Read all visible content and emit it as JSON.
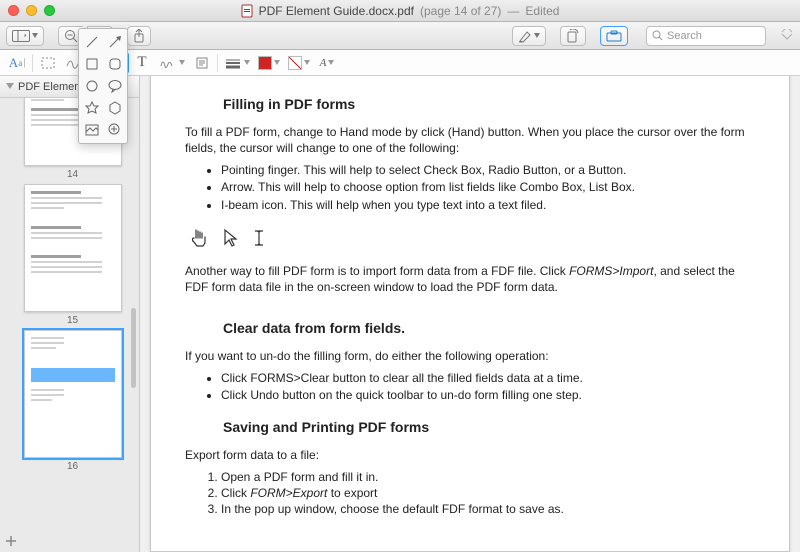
{
  "window": {
    "filename": "PDF Element Guide.docx.pdf",
    "page_indicator": "(page 14 of 27)",
    "edited_label": "Edited"
  },
  "topbar": {
    "search_placeholder": "Search"
  },
  "sidebar": {
    "tab_label": "PDF Element Guide",
    "thumbs": [
      {
        "label": "14"
      },
      {
        "label": "15"
      },
      {
        "label": "16",
        "selected": true
      }
    ]
  },
  "doc": {
    "h1": "Filling in PDF forms",
    "p1": "To fill a PDF form, change to Hand mode by click (Hand) button. When you place the cursor over the form fields, the cursor will change to one of the following:",
    "bul1": [
      "Pointing finger. This will help to select Check Box, Radio Button, or a Button.",
      "Arrow. This will help to choose option from list fields like Combo Box, List Box.",
      "I-beam icon. This will help when you type text into a text filed."
    ],
    "p2_pre": "Another way to fill PDF form is to import form data from a FDF file. Click ",
    "p2_em": "FORMS>Import",
    "p2_post": ", and select the FDF form data file in the on-screen window to load the PDF form data.",
    "h2": "Clear data from form fields.",
    "p3": "If you want to un-do the filling form, do either the following operation:",
    "bul2": [
      "Click FORMS>Clear button to clear all the filled fields data at a time.",
      "Click Undo button on the quick toolbar to un-do form filling one step."
    ],
    "h3": "Saving and Printing PDF forms",
    "p4": "Export form data to a file:",
    "num1": [
      "Open a PDF form and fill it in.",
      "Click FORM>Export to export",
      "In the pop up window, choose the default FDF format to save as."
    ]
  }
}
